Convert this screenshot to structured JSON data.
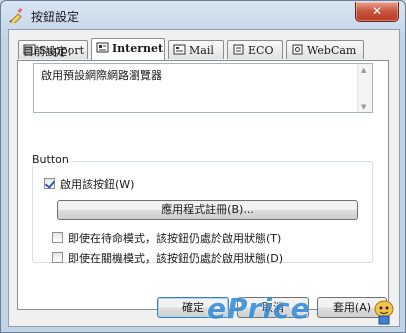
{
  "window": {
    "title": "按鈕設定",
    "close_glyph": "✕"
  },
  "tabs": [
    {
      "label": "Support",
      "icon": "support-icon",
      "active": false
    },
    {
      "label": "Internet",
      "icon": "internet-icon",
      "active": true
    },
    {
      "label": "Mail",
      "icon": "mail-icon",
      "active": false
    },
    {
      "label": "ECO",
      "icon": "eco-icon",
      "active": false
    },
    {
      "label": "WebCam",
      "icon": "webcam-icon",
      "active": false
    }
  ],
  "panel": {
    "current_label": "目前設定：",
    "current_value": "啟用預設網際網路瀏覽器",
    "group_title": "Button",
    "enable_checkbox": {
      "label": "啟用該按鈕(W)",
      "checked": true
    },
    "app_button_label": "應用程式註冊(B)...",
    "standby_checkbox": {
      "label": "即使在待命模式，該按鈕仍處於啟用狀態(T)",
      "checked": false
    },
    "shutdown_checkbox": {
      "label": "即使在關機模式，該按鈕仍處於啟用狀態(D)",
      "checked": false
    }
  },
  "footer": {
    "ok_label": "確定",
    "cancel_label": "取消",
    "apply_label": "套用(A)"
  },
  "watermark": {
    "text": "ePrice"
  },
  "colors": {
    "accent": "#2f8ad8",
    "close": "#c6533c",
    "check": "#2a5bb6"
  }
}
